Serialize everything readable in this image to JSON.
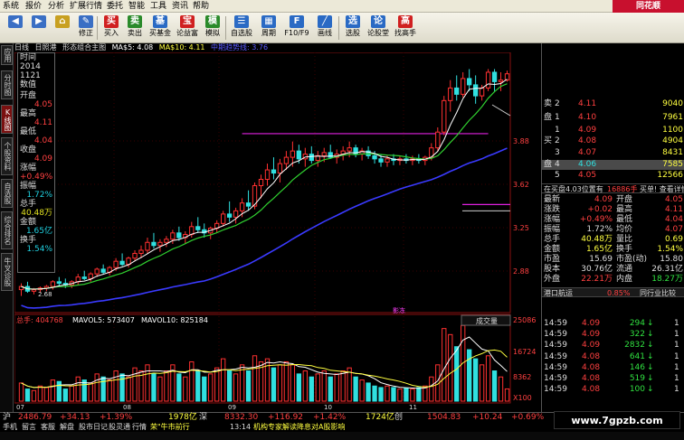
{
  "menubar": {
    "items": [
      "系统",
      "报价",
      "分析",
      "扩展行情",
      "委托",
      "智能",
      "工具",
      "资讯",
      "帮助"
    ],
    "brand": "同花顺"
  },
  "toolbar": {
    "buttons": [
      {
        "label": "",
        "icon": "back-icon",
        "color": "#3a6fc4"
      },
      {
        "label": "",
        "icon": "forward-icon",
        "color": "#3a6fc4"
      },
      {
        "label": "",
        "icon": "home-icon",
        "color": "#c8a020"
      },
      {
        "label": "修正",
        "icon": "edit-icon",
        "color": "#3a6fc4"
      },
      {
        "label": "买入",
        "icon": "buy-icon",
        "color": "#d02020"
      },
      {
        "label": "卖出",
        "icon": "sell-icon",
        "color": "#2a8a2a"
      },
      {
        "label": "买基金",
        "icon": "fund-icon",
        "color": "#2a6ac4"
      },
      {
        "label": "论益富",
        "icon": "profit-icon",
        "color": "#d02020"
      },
      {
        "label": "模拟",
        "icon": "simulate-icon",
        "color": "#2a8a2a"
      },
      {
        "label": "自选股",
        "icon": "watchlist-icon",
        "color": "#2a6ac4"
      },
      {
        "label": "周期",
        "icon": "period-icon",
        "color": "#2a6ac4"
      },
      {
        "label": "F10/F9",
        "icon": "f10-icon",
        "color": "#2a6ac4"
      },
      {
        "label": "画线",
        "icon": "draw-line-icon",
        "color": "#2a6ac4"
      },
      {
        "label": "选股",
        "icon": "stock-select-icon",
        "color": "#2a6ac4"
      },
      {
        "label": "论股堂",
        "icon": "forum-icon",
        "color": "#2a6ac4"
      },
      {
        "label": "找高手",
        "icon": "expert-icon",
        "color": "#d02020"
      }
    ]
  },
  "vtabs": [
    "应用",
    "分时图",
    "K线图",
    "个股资料",
    "自选股",
    "综合排名",
    "牛叉诊股"
  ],
  "chart_header": {
    "period": "日线",
    "indicator": "日照港",
    "template": "形态组合主图",
    "ma5": "MA$5: 4.08",
    "ma10": "MA$10: 4.11",
    "ma_mid": "中期趋势线: 3.76"
  },
  "data_panel": {
    "time_label": "时间",
    "year": "2014",
    "date": "1121",
    "value_label": "数值",
    "open_label": "开盘",
    "open": "4.05",
    "high_label": "最高",
    "high": "4.11",
    "low_label": "最低",
    "low": "4.04",
    "close_label": "收盘",
    "close": "4.09",
    "chg_label": "涨幅",
    "chg": "+0.49%",
    "amp_label": "振幅",
    "amp": "1.72%",
    "vol_label": "总手",
    "vol": "40.48万",
    "amt_label": "金额",
    "amt": "1.65亿",
    "turn_label": "换手",
    "turn": "1.54%"
  },
  "price_axis": [
    "3.88",
    "3.62",
    "3.25",
    "2.88",
    "2.68"
  ],
  "volume_header": {
    "total": "总手: 404768",
    "mavol5": "MAVOL5: 573407",
    "mavol10": "MAVOL10: 825184",
    "tag": "成交量",
    "max": "25086"
  },
  "volume_axis": [
    "25086",
    "16724",
    "8362",
    "X100"
  ],
  "date_axis": [
    "07",
    "08",
    "09",
    "10",
    "11"
  ],
  "chart_labels": {
    "rebound": "影冻"
  },
  "chart_data": {
    "type": "candlestick",
    "candles": [
      [
        2.72,
        2.76,
        2.68,
        2.74
      ],
      [
        2.74,
        2.77,
        2.7,
        2.71
      ],
      [
        2.71,
        2.73,
        2.69,
        2.72
      ],
      [
        2.72,
        2.74,
        2.7,
        2.73
      ],
      [
        2.73,
        2.75,
        2.71,
        2.74
      ],
      [
        2.74,
        2.78,
        2.72,
        2.77
      ],
      [
        2.77,
        2.8,
        2.74,
        2.76
      ],
      [
        2.76,
        2.79,
        2.73,
        2.75
      ],
      [
        2.75,
        2.78,
        2.73,
        2.77
      ],
      [
        2.77,
        2.82,
        2.75,
        2.8
      ],
      [
        2.8,
        2.84,
        2.78,
        2.79
      ],
      [
        2.79,
        2.83,
        2.77,
        2.82
      ],
      [
        2.82,
        2.86,
        2.8,
        2.85
      ],
      [
        2.85,
        2.88,
        2.82,
        2.83
      ],
      [
        2.83,
        2.87,
        2.81,
        2.86
      ],
      [
        2.86,
        2.92,
        2.84,
        2.9
      ],
      [
        2.9,
        2.95,
        2.87,
        2.88
      ],
      [
        2.88,
        2.93,
        2.86,
        2.92
      ],
      [
        2.92,
        2.97,
        2.9,
        2.95
      ],
      [
        2.95,
        3.0,
        2.92,
        2.97
      ],
      [
        2.97,
        3.05,
        2.95,
        3.02
      ],
      [
        3.02,
        3.08,
        2.98,
        3.0
      ],
      [
        3.0,
        3.04,
        2.96,
        3.02
      ],
      [
        3.02,
        3.06,
        2.99,
        3.04
      ],
      [
        3.04,
        3.1,
        3.01,
        3.08
      ],
      [
        3.08,
        3.12,
        3.03,
        3.05
      ],
      [
        3.05,
        3.09,
        3.01,
        3.07
      ],
      [
        3.07,
        3.15,
        3.05,
        3.12
      ],
      [
        3.12,
        3.18,
        3.08,
        3.1
      ],
      [
        3.1,
        3.14,
        3.05,
        3.08
      ],
      [
        3.08,
        3.12,
        3.04,
        3.11
      ],
      [
        3.11,
        3.16,
        3.08,
        3.14
      ],
      [
        3.14,
        3.22,
        3.12,
        3.2
      ],
      [
        3.2,
        3.28,
        3.15,
        3.18
      ],
      [
        3.18,
        3.24,
        3.14,
        3.22
      ],
      [
        3.22,
        3.3,
        3.18,
        3.27
      ],
      [
        3.27,
        3.35,
        3.22,
        3.25
      ],
      [
        3.25,
        3.4,
        3.23,
        3.38
      ],
      [
        3.38,
        3.45,
        3.3,
        3.42
      ],
      [
        3.42,
        3.52,
        3.38,
        3.48
      ],
      [
        3.48,
        3.56,
        3.42,
        3.46
      ],
      [
        3.46,
        3.55,
        3.4,
        3.52
      ],
      [
        3.52,
        3.6,
        3.48,
        3.56
      ],
      [
        3.56,
        3.66,
        3.5,
        3.6
      ],
      [
        3.6,
        3.64,
        3.52,
        3.55
      ],
      [
        3.55,
        3.62,
        3.5,
        3.58
      ],
      [
        3.58,
        3.63,
        3.52,
        3.54
      ],
      [
        3.54,
        3.6,
        3.5,
        3.57
      ],
      [
        3.57,
        3.62,
        3.53,
        3.59
      ],
      [
        3.59,
        3.64,
        3.55,
        3.56
      ],
      [
        3.56,
        3.61,
        3.52,
        3.58
      ],
      [
        3.58,
        3.63,
        3.54,
        3.6
      ],
      [
        3.6,
        3.66,
        3.56,
        3.62
      ],
      [
        3.62,
        3.64,
        3.56,
        3.58
      ],
      [
        3.58,
        3.62,
        3.54,
        3.6
      ],
      [
        3.6,
        3.63,
        3.55,
        3.57
      ],
      [
        3.57,
        3.6,
        3.52,
        3.55
      ],
      [
        3.55,
        3.58,
        3.5,
        3.53
      ],
      [
        3.53,
        3.57,
        3.5,
        3.55
      ],
      [
        3.55,
        3.58,
        3.51,
        3.54
      ],
      [
        3.54,
        3.57,
        3.51,
        3.55
      ],
      [
        3.55,
        3.58,
        3.52,
        3.54
      ],
      [
        3.54,
        3.57,
        3.51,
        3.55
      ],
      [
        3.55,
        3.58,
        3.52,
        3.54
      ],
      [
        3.54,
        3.57,
        3.51,
        3.56
      ],
      [
        3.56,
        3.65,
        3.54,
        3.62
      ],
      [
        3.62,
        3.75,
        3.6,
        3.72
      ],
      [
        3.72,
        3.95,
        3.7,
        3.92
      ],
      [
        3.92,
        4.05,
        3.85,
        4.0
      ],
      [
        4.0,
        4.08,
        3.92,
        3.96
      ],
      [
        3.96,
        4.1,
        3.94,
        4.06
      ],
      [
        4.06,
        4.12,
        3.98,
        4.02
      ],
      [
        4.02,
        4.08,
        3.9,
        3.95
      ],
      [
        3.95,
        4.02,
        3.92,
        4.0
      ],
      [
        4.0,
        4.12,
        3.98,
        4.1
      ],
      [
        4.1,
        4.12,
        3.98,
        4.04
      ],
      [
        4.04,
        4.1,
        3.98,
        4.05
      ],
      [
        4.05,
        4.11,
        4.04,
        4.09
      ]
    ],
    "volume": [
      6000,
      4000,
      3500,
      5000,
      4500,
      7000,
      6500,
      4000,
      5000,
      8000,
      7000,
      6000,
      9000,
      8000,
      7000,
      10000,
      9000,
      8000,
      11000,
      10000,
      12000,
      9000,
      8000,
      10000,
      12000,
      9000,
      8000,
      13000,
      10000,
      8000,
      9000,
      11000,
      14000,
      10000,
      9000,
      12000,
      10000,
      15000,
      13000,
      14000,
      11000,
      12000,
      13000,
      12000,
      9000,
      10000,
      8000,
      9000,
      10000,
      8000,
      9000,
      10000,
      11000,
      8000,
      7000,
      6000,
      5000,
      4500,
      5000,
      4500,
      4000,
      4200,
      4000,
      4500,
      5000,
      8000,
      12000,
      24000,
      22000,
      18000,
      25000,
      17000,
      14000,
      12000,
      15000,
      10000,
      8000,
      4048
    ],
    "ma_lines": [
      "MA5",
      "MA10",
      "中期趋势线"
    ],
    "resistance_level": 3.71,
    "ylim": [
      2.62,
      4.18
    ]
  },
  "quote_panel": {
    "sell_label": "卖",
    "buy_label": "买",
    "pan_label": "盘",
    "sells": [
      {
        "level": "2",
        "price": "4.11",
        "vol": "9040"
      },
      {
        "level": "1",
        "price": "4.10",
        "vol": "7961"
      }
    ],
    "buys": [
      {
        "level": "1",
        "price": "4.09",
        "vol": "1100"
      },
      {
        "level": "2",
        "price": "4.08",
        "vol": "4904"
      },
      {
        "level": "3",
        "price": "4.07",
        "vol": "8431"
      },
      {
        "level": "4",
        "price": "4.06",
        "vol": "7585"
      },
      {
        "level": "5",
        "price": "4.05",
        "vol": "12566"
      }
    ],
    "bar": {
      "left": "在买盘4.03位置有",
      "mid": "16886手",
      "right": "买单! 查看详情"
    },
    "stats": [
      {
        "l1": "最新",
        "v1": "4.09",
        "l2": "开盘",
        "v2": "4.05"
      },
      {
        "l1": "涨跌",
        "v1": "+0.02",
        "l2": "最高",
        "v2": "4.11"
      },
      {
        "l1": "涨幅",
        "v1": "+0.49%",
        "l2": "最低",
        "v2": "4.04"
      },
      {
        "l1": "振幅",
        "v1": "1.72%",
        "l2": "均价",
        "v2": "4.07"
      },
      {
        "l1": "总手",
        "v1": "40.48万",
        "l2": "量比",
        "v2": "0.69"
      },
      {
        "l1": "金额",
        "v1": "1.65亿",
        "l2": "换手",
        "v2": "1.54%"
      },
      {
        "l1": "市盈",
        "v1": "15.69",
        "l2": "市盈(动)",
        "v2": "15.80"
      },
      {
        "l1": "股本",
        "v1": "30.76亿",
        "l2": "流通",
        "v2": "26.31亿"
      },
      {
        "l1": "外盘",
        "v1": "22.21万",
        "l2": "内盘",
        "v2": "18.27万"
      }
    ],
    "tab_left": "港口航运",
    "tab_mid": "0.85%",
    "tab_right": "同行业比较",
    "ticks": [
      {
        "time": "14:59",
        "price": "4.09",
        "vol": "294",
        "dir": "down",
        "n": "1"
      },
      {
        "time": "14:59",
        "price": "4.09",
        "vol": "322",
        "dir": "down",
        "n": "1"
      },
      {
        "time": "14:59",
        "price": "4.09",
        "vol": "2832",
        "dir": "down",
        "n": "1"
      },
      {
        "time": "14:59",
        "price": "4.08",
        "vol": "641",
        "dir": "down",
        "n": "1"
      },
      {
        "time": "14:59",
        "price": "4.08",
        "vol": "146",
        "dir": "down",
        "n": "1"
      },
      {
        "time": "14:59",
        "price": "4.08",
        "vol": "519",
        "dir": "down",
        "n": "1"
      },
      {
        "time": "14:59",
        "price": "4.08",
        "vol": "100",
        "dir": "down",
        "n": "1"
      }
    ]
  },
  "status_bar": {
    "market1": "沪",
    "index1": "2486.79",
    "chg1": "+34.13",
    "pct1": "+1.39%",
    "amt1": "1978亿",
    "market2": "深",
    "index2": "8332.30",
    "chg2": "+116.92",
    "pct2": "+1.42%",
    "amt2": "1724亿",
    "market3": "创",
    "index3": "1504.83",
    "chg3": "+10.24",
    "pct3": "+0.69%"
  },
  "bottom_bar": {
    "items": [
      "手机",
      "留言",
      "客服",
      "解盘",
      "股市日记",
      "股灵通",
      "行情"
    ],
    "ticker_tag": "荣\"牛市前行",
    "news_time": "13:14",
    "news": "机构专家解读降息对A股影响"
  },
  "watermark": "www.7gpzb.com",
  "colors": {
    "up": "#ff3030",
    "down": "#30e0e0",
    "ma5": "#ffffff",
    "ma10": "#ffff40",
    "mid_trend": "#3a3aff",
    "resistance": "#e020e0",
    "green_line": "#30d030"
  }
}
